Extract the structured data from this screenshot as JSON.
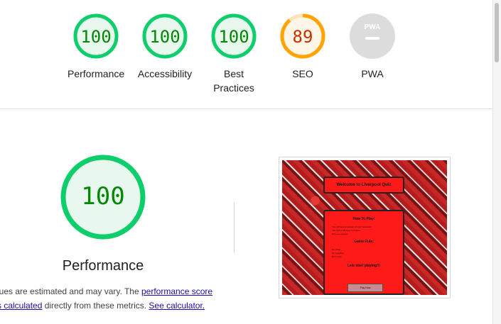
{
  "categories": [
    {
      "label": "Performance",
      "score": "100",
      "status": "pass"
    },
    {
      "label": "Accessibility",
      "score": "100",
      "status": "pass"
    },
    {
      "label": "Best Practices",
      "label_lines": [
        "Best",
        "Practices"
      ],
      "score": "100",
      "status": "pass"
    },
    {
      "label": "SEO",
      "score": "89",
      "status": "average"
    },
    {
      "label": "PWA",
      "score": "",
      "status": "na",
      "badge_text": "PWA"
    }
  ],
  "main": {
    "score": "100",
    "title": "Performance",
    "desc_part1": "lues are estimated and may vary. The ",
    "desc_link1": "performance score",
    "desc_link2": "s calculated",
    "desc_part2": " directly from these metrics. ",
    "desc_link3": "See calculator."
  },
  "screenshot": {
    "heading": "Welcome to Liverpool Quiz",
    "how_to_play": "How To Play:",
    "rules_title": "Game Rule:",
    "lines": [
      "You will have to answer 10 quiz questions",
      "You have 2 Minutes to answer",
      "Pick one answer"
    ],
    "rule_lines": [
      "No cheat",
      "No Googling",
      "Be honest"
    ],
    "cta": "Lets start playing!!!",
    "button": "Play Now"
  },
  "colors": {
    "pass": "#0cce6b",
    "pass_fill": "#e8f8ee",
    "pass_text": "#008800",
    "average": "#ffa400",
    "average_fill": "#fff5e6",
    "average_text": "#c33300",
    "na": "#dcdcdc"
  }
}
